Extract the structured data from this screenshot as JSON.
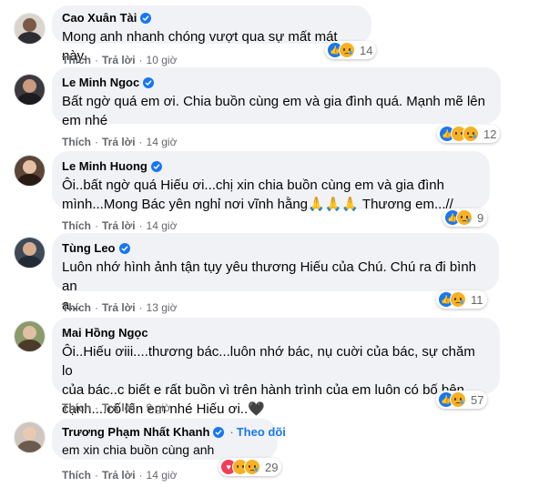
{
  "colors": {
    "accent": "#1877f2",
    "bubble": "#f0f2f5",
    "meta": "#65676b"
  },
  "actions": {
    "like_label": "Thích",
    "reply_label": "Trả lời",
    "separator": "·"
  },
  "comments": [
    {
      "author": "Cao Xuân Tài",
      "verified": true,
      "lines": [
        "Mong anh nhanh chóng vượt qua sự mất mát này."
      ],
      "time": "10 giờ",
      "reactions": [
        "like",
        "sad"
      ],
      "reaction_count": "14"
    },
    {
      "author": "Le Minh Ngoc",
      "verified": true,
      "lines": [
        "Bất ngờ quá em ơi. Chia buồn cùng em và gia đình quá. Mạnh mẽ lên",
        "em nhé"
      ],
      "time": "14 giờ",
      "reactions": [
        "like",
        "care",
        "sad"
      ],
      "reaction_count": "12"
    },
    {
      "author": "Le Minh Huong",
      "verified": true,
      "lines": [
        "Ôi..bất ngờ quá Hiếu ơi...chị xin chia buồn cùng em và gia đình",
        "mình...Mong Bác yên nghỉ nơi vĩnh hằng🙏🙏🙏 Thương em...//"
      ],
      "time": "14 giờ",
      "reactions": [
        "like",
        "sad"
      ],
      "reaction_count": "9"
    },
    {
      "author": "Tùng Leo",
      "verified": true,
      "lines": [
        "Luôn nhớ hình ảnh tận tụy yêu thương Hiếu của Chú. Chú ra đi bình an",
        "ạ..."
      ],
      "time": "13 giờ",
      "reactions": [
        "like",
        "sad"
      ],
      "reaction_count": "11"
    },
    {
      "author": "Mai Hồng Ngọc",
      "verified": false,
      "lines": [
        "Ôi..Hiếu ơiii....thương bác...luôn nhớ bác, nụ cuời của bác, sự chăm lo",
        "của bác..c biết e rất buồn vì trên hành trình của em luôn có bố bên",
        "cạnh....cố lên em nhé Hiếu ơi..🖤"
      ],
      "time": "9 giờ",
      "reactions": [
        "like",
        "sad"
      ],
      "reaction_count": "57"
    },
    {
      "author": "Trương Phạm Nhất Khanh",
      "verified": true,
      "follow_label": "Theo dõi",
      "lines": [
        "em xin chia buồn cùng anh"
      ],
      "time": "14 giờ",
      "reactions": [
        "love",
        "care",
        "sad"
      ],
      "reaction_count": "29"
    }
  ]
}
